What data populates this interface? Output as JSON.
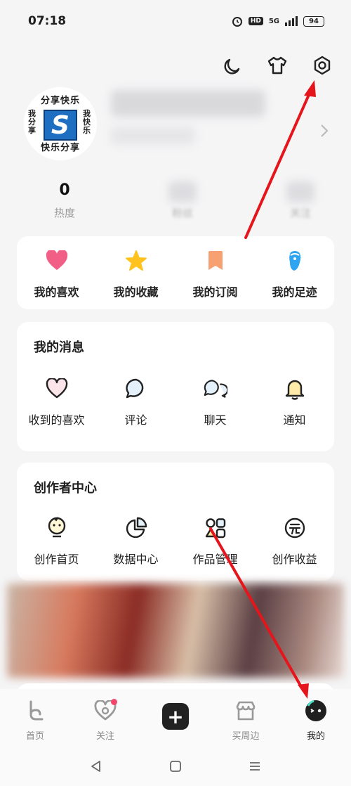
{
  "status_bar": {
    "time": "07:18",
    "hd": "HD",
    "network": "5G",
    "battery": "94"
  },
  "profile": {
    "avatar": {
      "top": "分享快乐",
      "bottom": "快乐分享",
      "left": "我分享",
      "right": "我快乐",
      "logo": "S"
    },
    "stats": [
      {
        "value": "0",
        "label": "热度"
      },
      {
        "value": "",
        "label": "粉丝"
      },
      {
        "value": "",
        "label": "关注"
      }
    ]
  },
  "quick_actions": [
    {
      "label": "我的喜欢",
      "icon": "heart-icon"
    },
    {
      "label": "我的收藏",
      "icon": "star-icon"
    },
    {
      "label": "我的订阅",
      "icon": "bookmark-icon"
    },
    {
      "label": "我的足迹",
      "icon": "footprint-icon"
    }
  ],
  "messages": {
    "title": "我的消息",
    "items": [
      {
        "label": "收到的喜欢",
        "icon": "heart-outline-icon"
      },
      {
        "label": "评论",
        "icon": "comment-icon"
      },
      {
        "label": "聊天",
        "icon": "chat-icon"
      },
      {
        "label": "通知",
        "icon": "bell-icon"
      }
    ]
  },
  "creator": {
    "title": "创作者中心",
    "items": [
      {
        "label": "创作首页",
        "icon": "creator-home-icon"
      },
      {
        "label": "数据中心",
        "icon": "pie-chart-icon"
      },
      {
        "label": "作品管理",
        "icon": "works-grid-icon"
      },
      {
        "label": "创作收益",
        "icon": "yuan-icon"
      }
    ]
  },
  "tab_bar": [
    {
      "label": "首页",
      "icon": "home-icon"
    },
    {
      "label": "关注",
      "icon": "follow-icon"
    },
    {
      "label": "",
      "icon": "plus-icon"
    },
    {
      "label": "买周边",
      "icon": "shop-icon"
    },
    {
      "label": "我的",
      "icon": "me-icon",
      "active": true
    }
  ],
  "colors": {
    "accent_red": "#e5151b",
    "heart": "#f25f86",
    "star": "#ffc21f",
    "bookmark": "#f7a072",
    "footprint": "#2fa4f0"
  }
}
